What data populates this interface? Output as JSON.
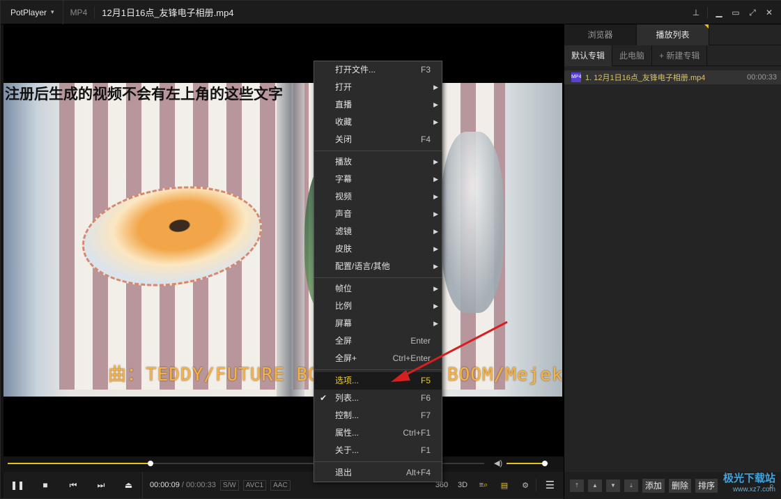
{
  "titlebar": {
    "app_name": "PotPlayer",
    "format": "MP4",
    "file_title": "12月1日16点_友锋电子相册.mp4",
    "buttons": [
      "pin-icon",
      "minimize-icon",
      "maximize-icon",
      "fullscreen-icon",
      "close-icon"
    ]
  },
  "video": {
    "subtitle_top": "注册后生成的视频不会有左上角的这些文字",
    "subtitle_bottom": "曲：TEDDY/FUTURE BOUNCE/Bekuh BOOM/Mejek"
  },
  "seek": {
    "progress": 0.3,
    "volume": 0.91
  },
  "controls": {
    "current_time": "00:00:09",
    "separator": "/",
    "duration": "00:00:33",
    "tags": [
      "S/W",
      "AVC1",
      "AAC"
    ],
    "right_icons": [
      "360",
      "3D"
    ]
  },
  "panel": {
    "tabs": [
      "浏览器",
      "播放列表"
    ],
    "active_tab": 1,
    "subtabs": [
      "默认专辑",
      "此电脑",
      "+ 新建专辑"
    ],
    "items": [
      {
        "index_name": "1. 12月1日16点_友锋电子相册.mp4",
        "duration": "00:00:33",
        "icon_text": "MP4"
      }
    ],
    "footer_buttons": [
      "添加",
      "删除",
      "排序"
    ],
    "watermark_main": "极光下载站",
    "watermark_sub": "www.xz7.com"
  },
  "context_menu": {
    "groups": [
      [
        {
          "label": "打开文件...",
          "shortcut": "F3"
        },
        {
          "label": "打开",
          "submenu": true
        },
        {
          "label": "直播",
          "submenu": true
        },
        {
          "label": "收藏",
          "submenu": true
        },
        {
          "label": "关闭",
          "shortcut": "F4"
        }
      ],
      [
        {
          "label": "播放",
          "submenu": true
        },
        {
          "label": "字幕",
          "submenu": true
        },
        {
          "label": "视频",
          "submenu": true
        },
        {
          "label": "声音",
          "submenu": true
        },
        {
          "label": "滤镜",
          "submenu": true
        },
        {
          "label": "皮肤",
          "submenu": true
        },
        {
          "label": "配置/语言/其他",
          "submenu": true
        }
      ],
      [
        {
          "label": "帧位",
          "submenu": true
        },
        {
          "label": "比例",
          "submenu": true
        },
        {
          "label": "屏幕",
          "submenu": true
        },
        {
          "label": "全屏",
          "shortcut": "Enter"
        },
        {
          "label": "全屏+",
          "shortcut": "Ctrl+Enter"
        }
      ],
      [
        {
          "label": "选项...",
          "shortcut": "F5",
          "highlighted": true
        },
        {
          "label": "列表...",
          "shortcut": "F6",
          "checked": true
        },
        {
          "label": "控制...",
          "shortcut": "F7"
        },
        {
          "label": "属性...",
          "shortcut": "Ctrl+F1"
        },
        {
          "label": "关于...",
          "shortcut": "F1"
        }
      ],
      [
        {
          "label": "退出",
          "shortcut": "Alt+F4"
        }
      ]
    ]
  },
  "colors": {
    "accent": "#e5c318",
    "highlight_text": "#f0cf2a",
    "annotation_arrow": "#d42020"
  }
}
